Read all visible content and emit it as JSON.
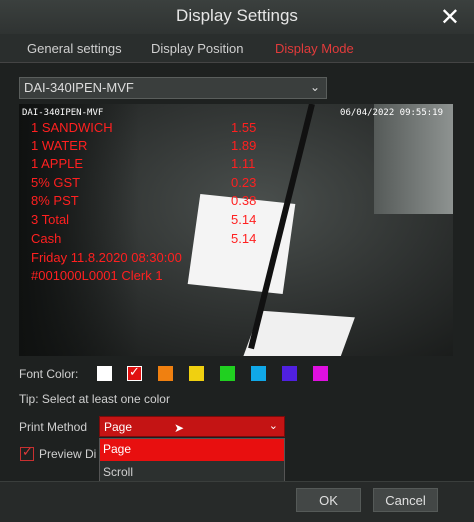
{
  "window": {
    "title": "Display Settings",
    "close_icon": "close-icon"
  },
  "tabs": [
    {
      "label": "General settings",
      "active": false
    },
    {
      "label": "Display Position",
      "active": false
    },
    {
      "label": "Display Mode",
      "active": true
    }
  ],
  "channel": {
    "selected": "DAI-340IPEN-MVF"
  },
  "preview": {
    "camera_label": "DAI-340IPEN-MVF",
    "datetime": "06/04/2022 09:55:19",
    "receipt_lines": [
      {
        "text": "1  SANDWICH",
        "value": "1.55"
      },
      {
        "text": "1  WATER",
        "value": "1.89"
      },
      {
        "text": "1  APPLE",
        "value": "1.11"
      },
      {
        "text": "5% GST",
        "value": "0.23"
      },
      {
        "text": "8% PST",
        "value": "0.38"
      },
      {
        "text": "3  Total",
        "value": "5.14"
      },
      {
        "text": "Cash",
        "value": "5.14"
      },
      {
        "text": "Friday   11.8.2020    08:30:00",
        "value": ""
      },
      {
        "text": "#001000L0001 Clerk 1",
        "value": ""
      }
    ]
  },
  "font_color": {
    "label": "Font Color:",
    "swatches": [
      "#ffffff",
      "#e01010",
      "#f08010",
      "#f0d010",
      "#20d020",
      "#10a8e8",
      "#5020e0",
      "#e010e0"
    ],
    "selected_index": 1
  },
  "tip": "Tip: Select at least one color",
  "print_method": {
    "label": "Print Method",
    "selected": "Page",
    "options": [
      "Page",
      "Scroll"
    ]
  },
  "preview_check": {
    "label": "Preview Di",
    "checked": true
  },
  "buttons": {
    "ok": "OK",
    "cancel": "Cancel"
  },
  "colors": {
    "accent": "#e23b3b",
    "dropdown_red": "#c41414"
  }
}
